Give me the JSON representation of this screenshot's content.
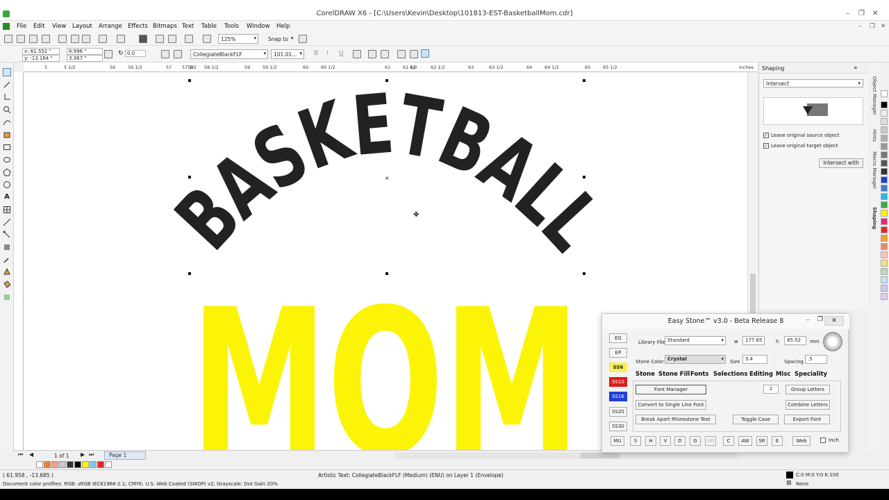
{
  "window": {
    "title": "CorelDRAW X6 - [C:\\Users\\Kevin\\Desktop\\101813-EST-BasketballMom.cdr]",
    "controls": [
      "–",
      "❐",
      "✕"
    ]
  },
  "menu": [
    "File",
    "Edit",
    "View",
    "Layout",
    "Arrange",
    "Effects",
    "Bitmaps",
    "Text",
    "Table",
    "Tools",
    "Window",
    "Help"
  ],
  "toolbar": {
    "zoom": "125%",
    "snap_to": "Snap to"
  },
  "property_bar": {
    "x": "x: 61.552 \"",
    "y": "y: -13.164 \"",
    "w": "6.996 \"",
    "h": "3.367 \"",
    "angle": "0.0",
    "font": "CollegiateBlackFLF",
    "font_size": "101.01..."
  },
  "ruler": {
    "ticks": [
      "5",
      "5 1/2",
      "56",
      "56 1/2",
      "57",
      "57 1/2",
      "58",
      "58 1/2",
      "59",
      "59 1/2",
      "60",
      "60 1/2",
      "61",
      "61 1/2",
      "62",
      "62 1/2",
      "63",
      "63 1/2",
      "64",
      "64 1/2",
      "65",
      "65 1/2"
    ],
    "unit": "inches"
  },
  "artwork": {
    "top_text": "BASKETBALL",
    "bottom_text": "MOM",
    "top_color": "#222222",
    "bottom_color": "#fbf406"
  },
  "page_nav": {
    "count": "1 of 1",
    "tab": "Page 1"
  },
  "status": {
    "coords": "( 61.958 , -13.685 )",
    "object_info": "Artistic Text: CollegiateBlackFLF (Medium) (ENU) on Layer 1  (Envelope)",
    "color_profiles": "Document color profiles: RGB: sRGB IEC61966-2.1; CMYK: U.S. Web Coated (SWOP) v2; Grayscale: Dot Gain 20%",
    "fill": "C:0 M:0 Y:0 K:100",
    "outline": "None"
  },
  "docker": {
    "title": "Shaping",
    "mode": "Intersect",
    "leave_source": "Leave original source object",
    "leave_target": "Leave original target object",
    "button": "Intersect with",
    "tabs": [
      "Object Manager",
      "Hints",
      "Macro Manager",
      "Shaping"
    ]
  },
  "easystone": {
    "title": "Easy Stone™ v3.0 - Beta Release 8",
    "side_buttons": [
      "EG",
      "EP",
      "SS6",
      "SS10",
      "SS16",
      "SS20",
      "SS30"
    ],
    "library_label": "Library File",
    "library_value": "Standard",
    "w_label": "w",
    "w_value": "177.65",
    "h_label": "h",
    "h_value": "85.52",
    "unit": "mm",
    "stone_color_label": "Stone Color",
    "stone_color_value": "Crystal",
    "size_label": "Size",
    "size_value": "3.4",
    "spacing_label": "Spacing",
    "spacing_value": ".5",
    "tabs": [
      "Stone",
      "Stone Fill",
      "Fonts",
      "Selections",
      "Editing",
      "Misc",
      "Speciality"
    ],
    "font_manager": "Font Manager",
    "convert_single": "Convert to Single Line Font",
    "break_apart": "Break Apart Rhinestone Text",
    "group_count": "2",
    "group_letters": "Group Letters",
    "combine_letters": "Combine Letters",
    "toggle_case": "Toggle Case",
    "export_font": "Export Font",
    "bottom_buttons": [
      "MU",
      "S",
      "H",
      "V",
      "D",
      "G",
      "UG",
      "C",
      "AW",
      "SR",
      "E",
      "Web"
    ],
    "inch_label": "Inch"
  },
  "colors": {
    "ss6": "#f6ee5a",
    "ss10": "#d91e1e",
    "ss16": "#1f3fd9"
  }
}
